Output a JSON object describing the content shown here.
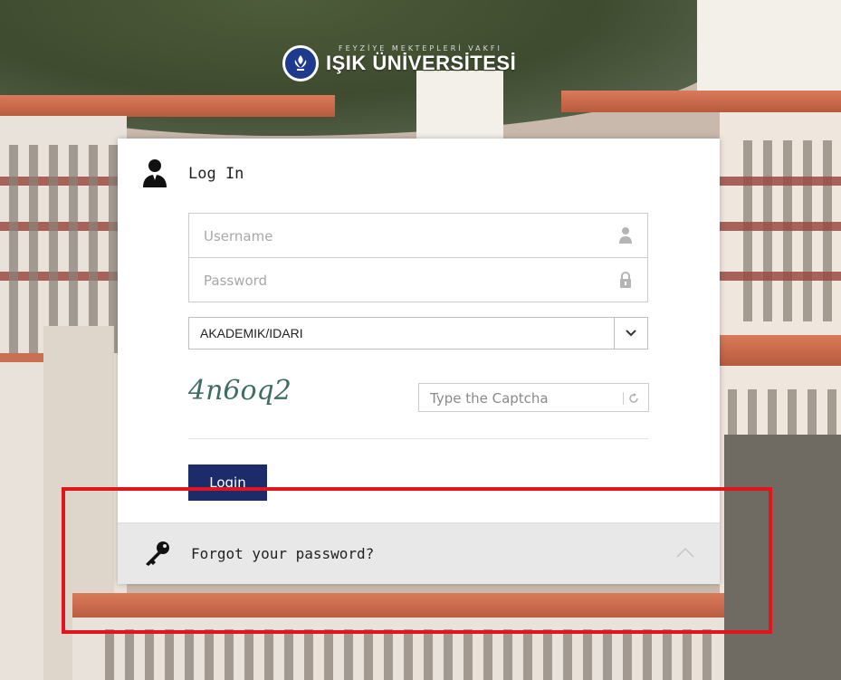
{
  "logo": {
    "tagline": "FEYZİYE MEKTEPLERİ VAKFI",
    "name": "IŞIK ÜNİVERSİTESİ"
  },
  "login": {
    "title": "Log In",
    "username_placeholder": "Username",
    "password_placeholder": "Password",
    "domain_selected": "AKADEMIK/IDARI",
    "captcha_text": "4n6oq2",
    "captcha_placeholder": "Type the Captcha",
    "login_button": "Login"
  },
  "forgot": {
    "label": "Forgot your password?"
  },
  "icons": {
    "user": "user-icon",
    "username": "person-icon",
    "password": "lock-icon",
    "dropdown": "chevron-down-icon",
    "refresh": "refresh-icon",
    "key": "key-icon",
    "expand": "chevron-up-icon"
  },
  "colors": {
    "login_button": "#1d2b6b",
    "highlight": "#e1161d",
    "logo_mark": "#1e3a8f"
  }
}
